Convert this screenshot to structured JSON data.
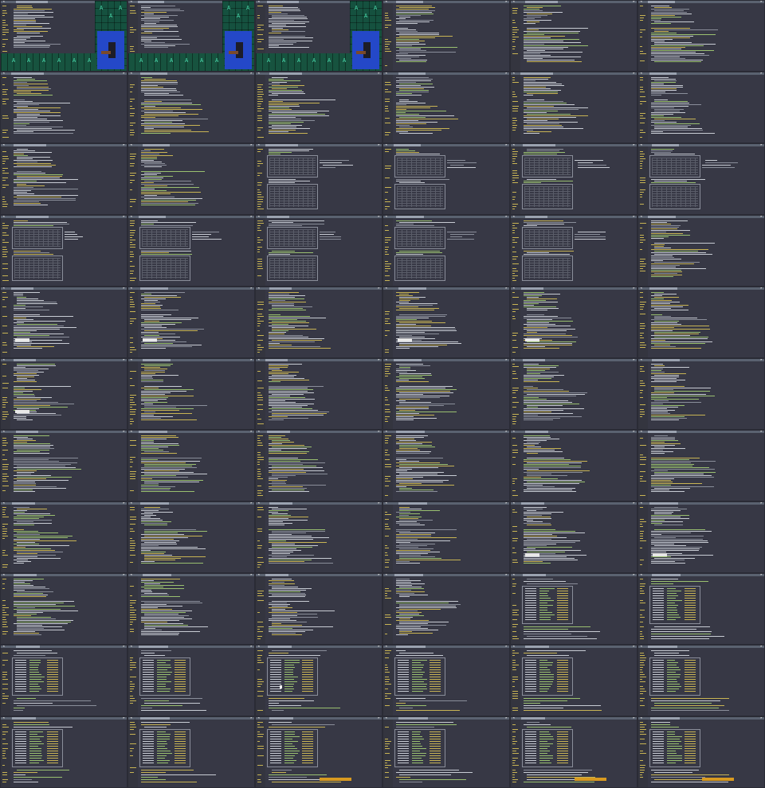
{
  "screen": {
    "description_cols": 6,
    "description_rows": 11
  },
  "tiles": [
    {
      "kind": "game",
      "top": "tab"
    },
    {
      "kind": "game",
      "top": "tab"
    },
    {
      "kind": "game",
      "top": "tab"
    },
    {
      "kind": "text",
      "top": "tab"
    },
    {
      "kind": "text",
      "top": "tab"
    },
    {
      "kind": "text",
      "top": "tab"
    },
    {
      "kind": "text",
      "top": "tab"
    },
    {
      "kind": "text",
      "top": "tab"
    },
    {
      "kind": "text",
      "top": "tab"
    },
    {
      "kind": "text",
      "top": "tab"
    },
    {
      "kind": "text",
      "top": "tab"
    },
    {
      "kind": "text",
      "top": "tab"
    },
    {
      "kind": "text",
      "top": "tab"
    },
    {
      "kind": "text",
      "top": "tab"
    },
    {
      "kind": "grid",
      "top": "tab"
    },
    {
      "kind": "grid",
      "top": "tab"
    },
    {
      "kind": "grid",
      "top": "tab"
    },
    {
      "kind": "grid",
      "top": "tab"
    },
    {
      "kind": "grid",
      "top": "tab"
    },
    {
      "kind": "grid",
      "top": "tab"
    },
    {
      "kind": "grid",
      "top": "tab"
    },
    {
      "kind": "grid",
      "top": "tab"
    },
    {
      "kind": "grid",
      "top": "tab"
    },
    {
      "kind": "text",
      "top": "tab"
    },
    {
      "kind": "text",
      "hl": "white",
      "top": "tab"
    },
    {
      "kind": "text",
      "hl": "white",
      "top": "tab"
    },
    {
      "kind": "text",
      "top": "tab"
    },
    {
      "kind": "text",
      "hl": "white",
      "top": "tab"
    },
    {
      "kind": "text",
      "hl": "white",
      "top": "tab"
    },
    {
      "kind": "text",
      "top": "tab"
    },
    {
      "kind": "text",
      "hl": "white",
      "top": "tab"
    },
    {
      "kind": "text",
      "top": "tab"
    },
    {
      "kind": "text",
      "top": "tab"
    },
    {
      "kind": "text",
      "top": "tab"
    },
    {
      "kind": "text",
      "top": "tab"
    },
    {
      "kind": "text",
      "top": "tab"
    },
    {
      "kind": "text",
      "top": "tab"
    },
    {
      "kind": "text",
      "top": "tab"
    },
    {
      "kind": "text",
      "top": "tab"
    },
    {
      "kind": "text",
      "top": "tab"
    },
    {
      "kind": "text",
      "top": "tab"
    },
    {
      "kind": "text",
      "top": "tab"
    },
    {
      "kind": "text",
      "top": "tab"
    },
    {
      "kind": "text",
      "top": "tab"
    },
    {
      "kind": "text",
      "top": "tab"
    },
    {
      "kind": "text",
      "top": "tab"
    },
    {
      "kind": "text",
      "hl": "white",
      "top": "tab"
    },
    {
      "kind": "text",
      "hl": "white",
      "top": "tab"
    },
    {
      "kind": "text",
      "top": "tab"
    },
    {
      "kind": "text",
      "top": "tab"
    },
    {
      "kind": "text",
      "top": "tab"
    },
    {
      "kind": "text",
      "top": "tab"
    },
    {
      "kind": "table",
      "top": "tab"
    },
    {
      "kind": "table",
      "top": "tab"
    },
    {
      "kind": "table",
      "top": "tab"
    },
    {
      "kind": "table",
      "top": "tab"
    },
    {
      "kind": "table",
      "top": "tab",
      "cursor": true
    },
    {
      "kind": "table",
      "top": "tab"
    },
    {
      "kind": "table",
      "top": "tab"
    },
    {
      "kind": "table",
      "top": "tab"
    },
    {
      "kind": "table",
      "top": "tab"
    },
    {
      "kind": "table",
      "top": "tab"
    },
    {
      "kind": "table",
      "hl": "amber",
      "top": "tab"
    },
    {
      "kind": "table",
      "top": "tab"
    },
    {
      "kind": "table",
      "hl": "amber",
      "top": "tab"
    },
    {
      "kind": "table",
      "hl": "amber",
      "top": "tab"
    }
  ],
  "colors": {
    "background": "#3a3b48",
    "text_light": "#c8ccd4",
    "text_yellow": "#c8b454",
    "text_green": "#9ac070",
    "text_dim": "#8a8e9a",
    "game_green": "#15513f",
    "game_blue": "#2448c8",
    "highlight_amber": "#d89a20"
  },
  "icons": {
    "close": "close-icon",
    "menu": "menu-icon",
    "game_sprite": "A"
  }
}
